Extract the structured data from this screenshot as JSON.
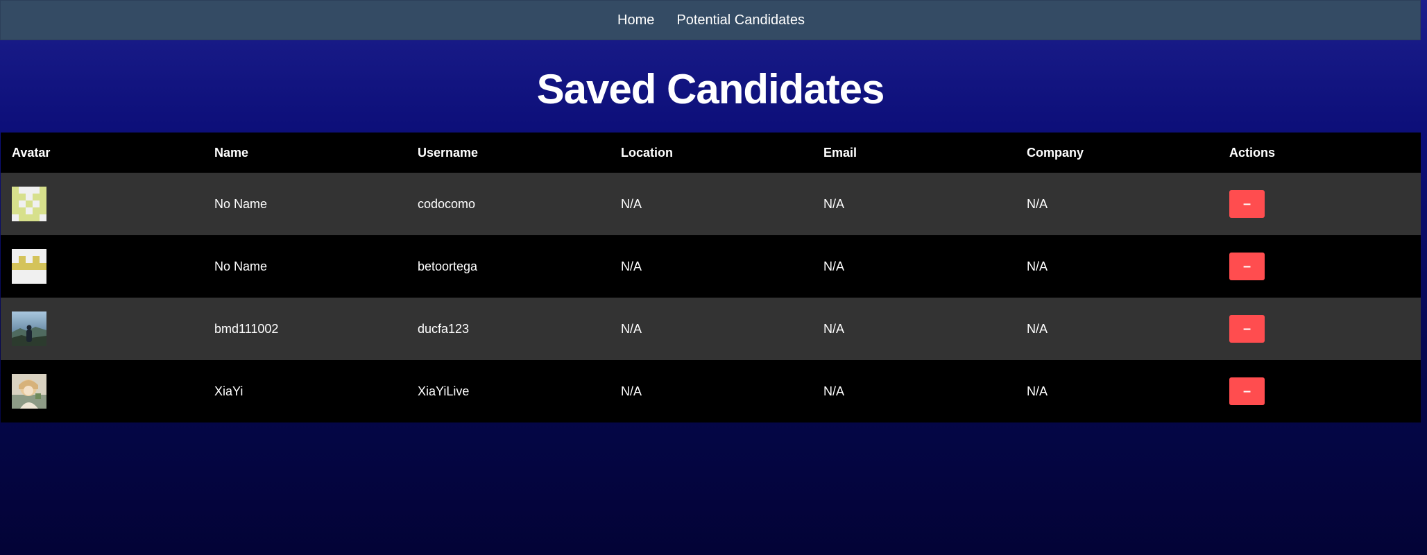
{
  "nav": {
    "items": [
      {
        "label": "Home"
      },
      {
        "label": "Potential Candidates"
      }
    ]
  },
  "page": {
    "title": "Saved Candidates"
  },
  "table": {
    "headers": [
      "Avatar",
      "Name",
      "Username",
      "Location",
      "Email",
      "Company",
      "Actions"
    ],
    "rows": [
      {
        "avatar": "identicon-green",
        "name": "No Name",
        "username": "codocomo",
        "location": "N/A",
        "email": "N/A",
        "company": "N/A",
        "action_label": "–"
      },
      {
        "avatar": "identicon-yellow",
        "name": "No Name",
        "username": "betoortega",
        "location": "N/A",
        "email": "N/A",
        "company": "N/A",
        "action_label": "–"
      },
      {
        "avatar": "photo-mountain",
        "name": "bmd111002",
        "username": "ducfa123",
        "location": "N/A",
        "email": "N/A",
        "company": "N/A",
        "action_label": "–"
      },
      {
        "avatar": "photo-anime",
        "name": "XiaYi",
        "username": "XiaYiLive",
        "location": "N/A",
        "email": "N/A",
        "company": "N/A",
        "action_label": "–"
      }
    ]
  },
  "colors": {
    "nav_bg": "#344b64",
    "remove_button": "#ff4d4f",
    "row_alt": "#333333"
  }
}
